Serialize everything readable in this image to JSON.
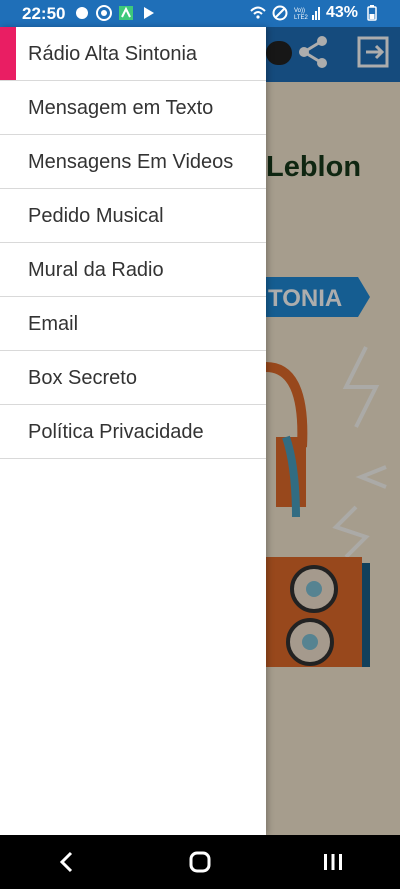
{
  "status": {
    "time": "22:50",
    "battery": "43%",
    "network_label": "Vo)) LTE2"
  },
  "drawer": {
    "items": [
      {
        "label": "Rádio Alta Sintonia"
      },
      {
        "label": "Mensagem em Texto"
      },
      {
        "label": "Mensagens Em Videos"
      },
      {
        "label": "Pedido Musical"
      },
      {
        "label": "Mural da Radio"
      },
      {
        "label": "Email"
      },
      {
        "label": "Box Secreto"
      },
      {
        "label": "Política Privacidade"
      }
    ]
  },
  "background": {
    "title_fragment": "Leblon",
    "banner_fragment": "TONIA"
  },
  "colors": {
    "accent": "#e91e63",
    "header": "#1f6fb8",
    "background": "#f5e8d0"
  }
}
